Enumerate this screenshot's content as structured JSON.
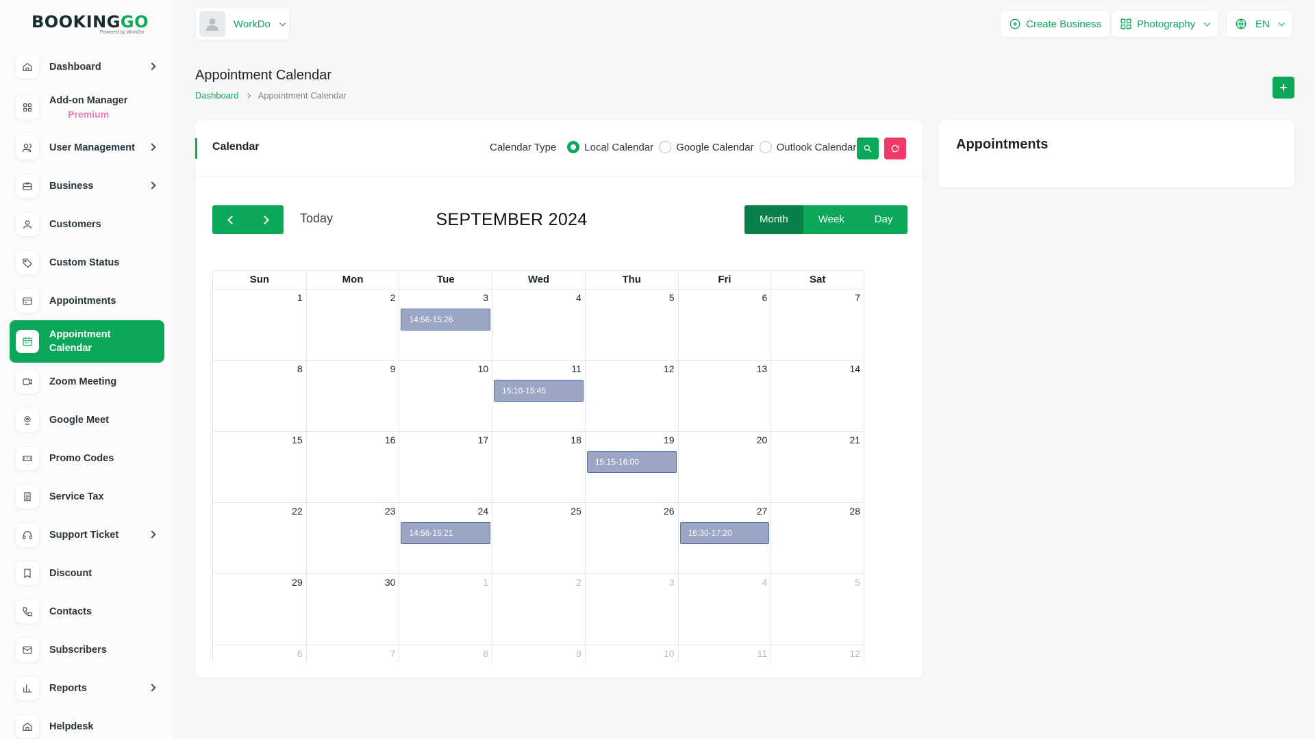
{
  "brand": {
    "logo_main_a": "BOOKING",
    "logo_main_b": "GO",
    "logo_sub": "Powered by WorkDo"
  },
  "sidebar": {
    "items": [
      {
        "label": "Dashboard",
        "icon": "home-icon",
        "has_children": true
      },
      {
        "label": "Add-on Manager",
        "sub": "Premium",
        "icon": "grid-icon",
        "has_children": false
      },
      {
        "label": "User Management",
        "icon": "users-icon",
        "has_children": true
      },
      {
        "label": "Business",
        "icon": "briefcase-icon",
        "has_children": true
      },
      {
        "label": "Customers",
        "icon": "user-icon",
        "has_children": false
      },
      {
        "label": "Custom Status",
        "icon": "tag-icon",
        "has_children": false
      },
      {
        "label": "Appointments",
        "icon": "card-icon",
        "has_children": false
      },
      {
        "label": "Appointment Calendar",
        "icon": "calendar-icon",
        "has_children": false,
        "active": true
      },
      {
        "label": "Zoom Meeting",
        "icon": "video-icon",
        "has_children": false
      },
      {
        "label": "Google Meet",
        "icon": "meet-icon",
        "has_children": false
      },
      {
        "label": "Promo Codes",
        "icon": "ticket-icon",
        "has_children": false
      },
      {
        "label": "Service Tax",
        "icon": "receipt-icon",
        "has_children": false
      },
      {
        "label": "Support Ticket",
        "icon": "headset-icon",
        "has_children": true
      },
      {
        "label": "Discount",
        "icon": "bookmark-icon",
        "has_children": false
      },
      {
        "label": "Contacts",
        "icon": "phone-icon",
        "has_children": false
      },
      {
        "label": "Subscribers",
        "icon": "mail-icon",
        "has_children": false
      },
      {
        "label": "Reports",
        "icon": "chart-icon",
        "has_children": true
      },
      {
        "label": "Helpdesk",
        "icon": "home-icon",
        "has_children": false
      }
    ]
  },
  "topbar": {
    "workspace_name": "WorkDo",
    "create_business": "Create Business",
    "category": "Photography",
    "language": "EN"
  },
  "page": {
    "title": "Appointment Calendar",
    "breadcrumb": [
      "Dashboard",
      "Appointment Calendar"
    ],
    "add_label": "+"
  },
  "calendar": {
    "card_title": "Calendar",
    "type_label": "Calendar Type",
    "types": [
      "Local Calendar",
      "Google Calendar",
      "Outlook Calendar"
    ],
    "selected_type": "Local Calendar",
    "today_label": "Today",
    "month_title": "SEPTEMBER 2024",
    "views": [
      "Month",
      "Week",
      "Day"
    ],
    "selected_view": "Month",
    "weekdays": [
      "Sun",
      "Mon",
      "Tue",
      "Wed",
      "Thu",
      "Fri",
      "Sat"
    ],
    "weeks": [
      [
        {
          "d": "1"
        },
        {
          "d": "2"
        },
        {
          "d": "3",
          "ev": "14:56-15:26"
        },
        {
          "d": "4"
        },
        {
          "d": "5"
        },
        {
          "d": "6"
        },
        {
          "d": "7"
        }
      ],
      [
        {
          "d": "8"
        },
        {
          "d": "9"
        },
        {
          "d": "10"
        },
        {
          "d": "11",
          "ev": "15:10-15:45"
        },
        {
          "d": "12"
        },
        {
          "d": "13"
        },
        {
          "d": "14"
        }
      ],
      [
        {
          "d": "15"
        },
        {
          "d": "16"
        },
        {
          "d": "17"
        },
        {
          "d": "18"
        },
        {
          "d": "19",
          "ev": "15:15-16:00"
        },
        {
          "d": "20"
        },
        {
          "d": "21"
        }
      ],
      [
        {
          "d": "22"
        },
        {
          "d": "23"
        },
        {
          "d": "24",
          "ev": "14:56-15:21"
        },
        {
          "d": "25"
        },
        {
          "d": "26"
        },
        {
          "d": "27",
          "ev": "16:30-17:20"
        },
        {
          "d": "28"
        }
      ],
      [
        {
          "d": "29"
        },
        {
          "d": "30"
        },
        {
          "d": "1",
          "other": true
        },
        {
          "d": "2",
          "other": true
        },
        {
          "d": "3",
          "other": true
        },
        {
          "d": "4",
          "other": true
        },
        {
          "d": "5",
          "other": true
        }
      ],
      [
        {
          "d": "6",
          "other": true
        },
        {
          "d": "7",
          "other": true
        },
        {
          "d": "8",
          "other": true
        },
        {
          "d": "9",
          "other": true
        },
        {
          "d": "10",
          "other": true
        },
        {
          "d": "11",
          "other": true
        },
        {
          "d": "12",
          "other": true
        }
      ]
    ]
  },
  "appointments": {
    "title": "Appointments"
  },
  "colors": {
    "accent": "#0ca85a",
    "accent_dark": "#088047",
    "danger": "#f0386b",
    "event_bg": "#9ba6c5",
    "event_border": "#4f6fb3"
  }
}
